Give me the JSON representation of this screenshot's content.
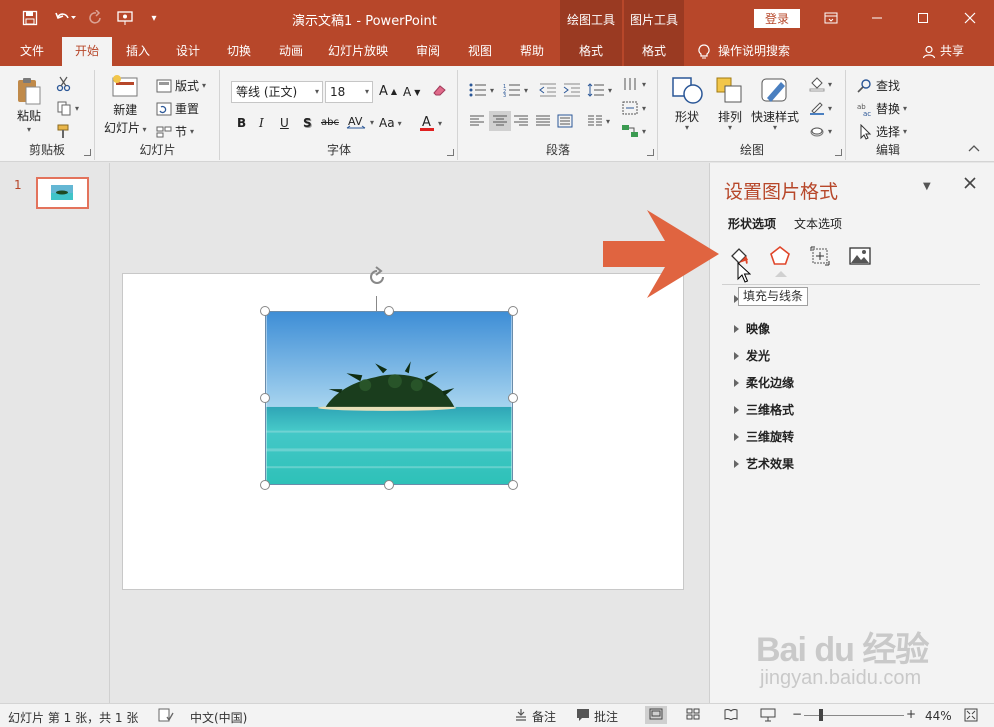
{
  "titlebar": {
    "doc_title": "演示文稿1 - PowerPoint",
    "drawing_tools": "绘图工具",
    "picture_tools": "图片工具",
    "login": "登录"
  },
  "tabs": [
    "文件",
    "开始",
    "插入",
    "设计",
    "切换",
    "动画",
    "幻灯片放映",
    "审阅",
    "视图",
    "帮助",
    "格式",
    "格式"
  ],
  "tell_me": "操作说明搜索",
  "share": "共享",
  "ribbon": {
    "clipboard": {
      "label": "剪贴板",
      "paste": "粘贴"
    },
    "slides": {
      "label": "幻灯片",
      "new_slide_1": "新建",
      "new_slide_2": "幻灯片",
      "layout": "版式",
      "reset": "重置",
      "section": "节"
    },
    "font": {
      "label": "字体",
      "font_name": "等线 (正文)",
      "font_size": "18",
      "bold": "B",
      "italic": "I",
      "underline": "U",
      "shadow": "S",
      "strike": "abc"
    },
    "paragraph": {
      "label": "段落"
    },
    "drawing": {
      "label": "绘图",
      "shapes": "形状",
      "arrange": "排列",
      "quick_styles": "快速样式"
    },
    "editing": {
      "label": "编辑",
      "find": "查找",
      "replace": "替换",
      "select": "选择"
    }
  },
  "thumbs": {
    "slide_number": "1"
  },
  "pane": {
    "title": "设置图片格式",
    "tabs": [
      "形状选项",
      "文本选项"
    ],
    "tooltip": "填充与线条",
    "sections": [
      "映像",
      "发光",
      "柔化边缘",
      "三维格式",
      "三维旋转",
      "艺术效果"
    ]
  },
  "status": {
    "slide_info": "幻灯片 第 1 张，共 1 张",
    "language": "中文(中国)",
    "notes": "备注",
    "comments": "批注",
    "zoom": "44%"
  },
  "watermark": {
    "logo": "Bai du 经验",
    "url": "jingyan.baidu.com"
  },
  "colors": {
    "accent": "#b7472a",
    "context": "#9a3a22",
    "arrow": "#e06440"
  }
}
